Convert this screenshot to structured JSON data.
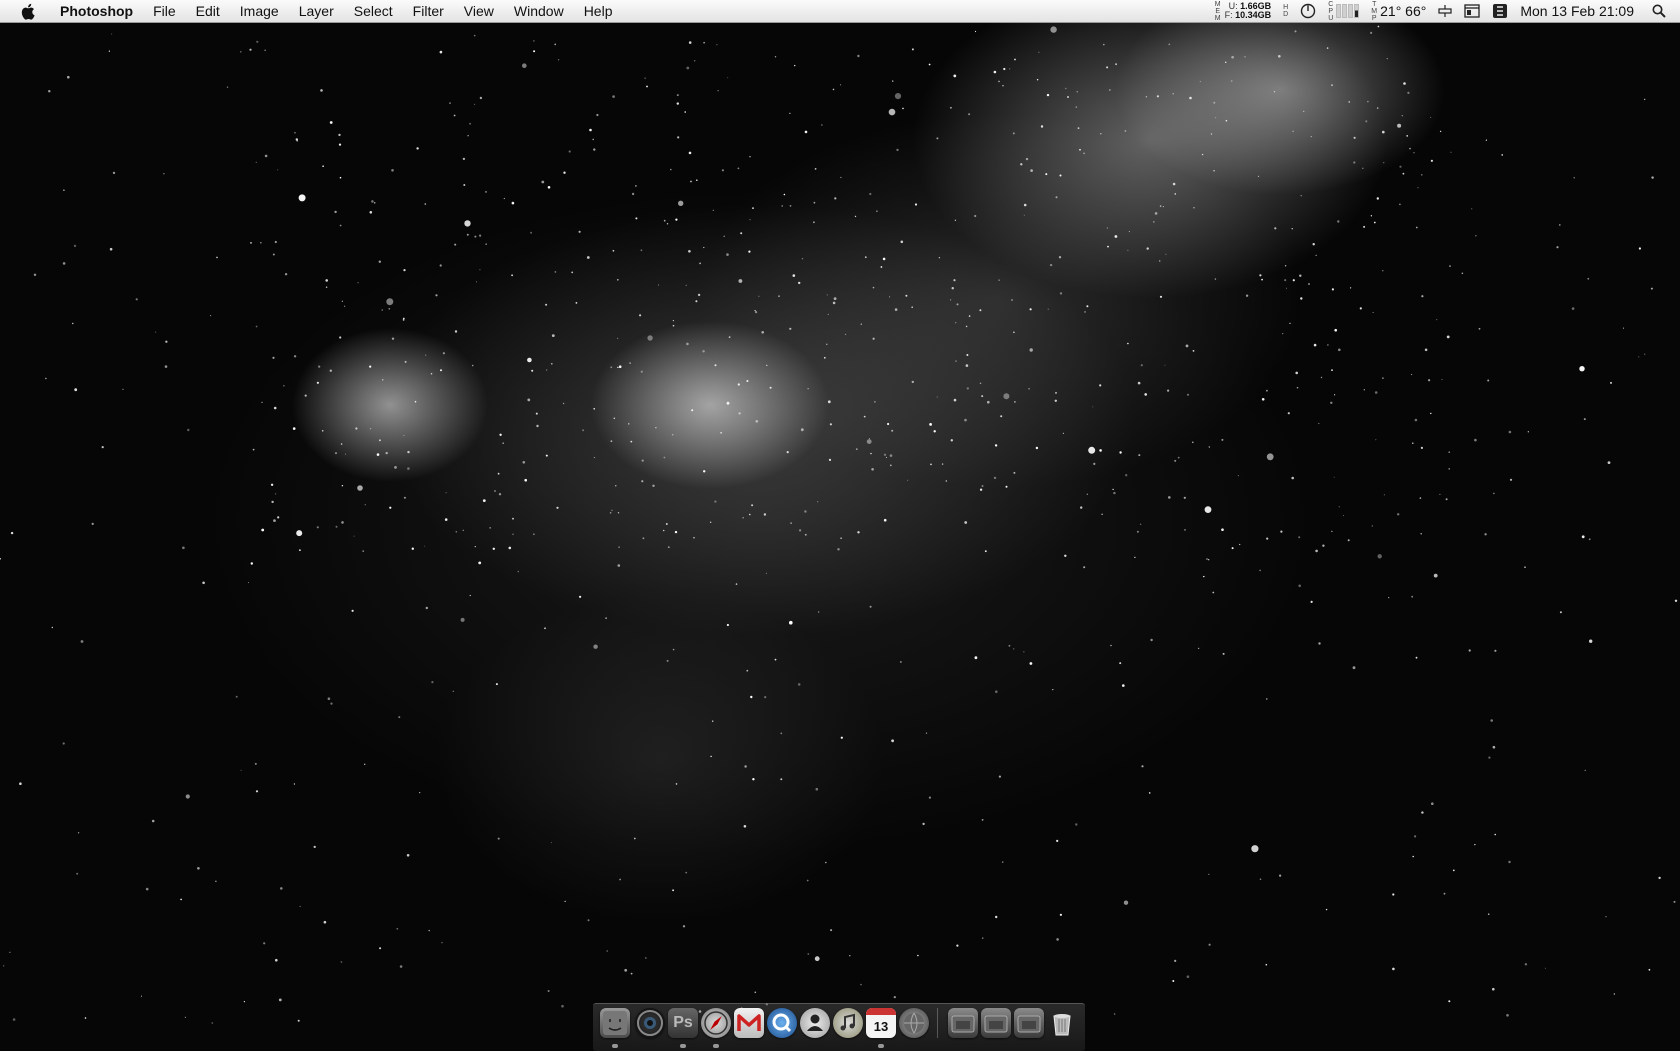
{
  "menubar": {
    "app_name": "Photoshop",
    "items": [
      "File",
      "Edit",
      "Image",
      "Layer",
      "Select",
      "Filter",
      "View",
      "Window",
      "Help"
    ],
    "status": {
      "mem_used_label": "U:",
      "mem_used": "1.66GB",
      "mem_free_label": "F:",
      "mem_free": "10.34GB",
      "temperature": "21° 66°",
      "datetime": "Mon 13 Feb  21:09"
    }
  },
  "dock": {
    "items": [
      {
        "name": "finder",
        "icon": "finder-icon"
      },
      {
        "name": "aperture",
        "icon": "aperture-icon"
      },
      {
        "name": "photoshop",
        "icon": "photoshop-icon",
        "label": "Ps"
      },
      {
        "name": "safari",
        "icon": "compass-icon"
      },
      {
        "name": "gmail",
        "icon": "mail-m-icon"
      },
      {
        "name": "quicktime",
        "icon": "quicktime-icon"
      },
      {
        "name": "address-book",
        "icon": "contacts-icon"
      },
      {
        "name": "itunes",
        "icon": "music-note-icon"
      },
      {
        "name": "ical",
        "icon": "calendar-icon",
        "label": "13"
      },
      {
        "name": "firefox",
        "icon": "globe-icon"
      },
      {
        "name": "folder-1",
        "icon": "folder-icon"
      },
      {
        "name": "folder-2",
        "icon": "folder-icon"
      },
      {
        "name": "folder-3",
        "icon": "folder-icon"
      },
      {
        "name": "trash",
        "icon": "trash-icon"
      }
    ]
  }
}
